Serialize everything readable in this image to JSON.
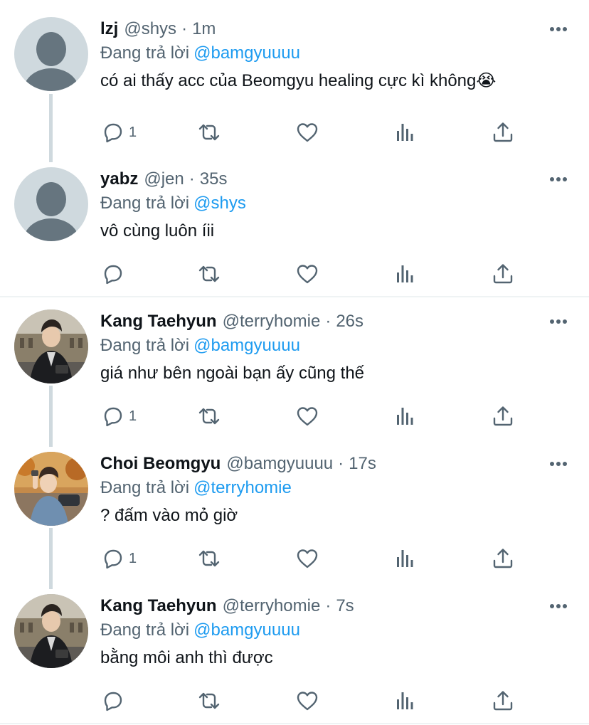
{
  "tweets": [
    {
      "name": "lzj",
      "handle": "@shys",
      "separator": "·",
      "time": "1m",
      "reply_prefix": "Đang trả lời",
      "reply_to": "@bamgyuuuu",
      "text": "có ai thấy acc của Beomgyu healing cực kì không😭",
      "reply_count": "1",
      "avatar": "default-avatar"
    },
    {
      "name": "yabz",
      "handle": "@jen",
      "separator": "·",
      "time": "35s",
      "reply_prefix": "Đang trả lời",
      "reply_to": "@shys",
      "text": "vô cùng luôn íii",
      "reply_count": "",
      "avatar": "default-avatar"
    },
    {
      "name": "Kang Taehyun",
      "handle": "@terryhomie",
      "separator": "·",
      "time": "26s",
      "reply_prefix": "Đang trả lời",
      "reply_to": "@bamgyuuuu",
      "text": "giá như bên ngoài bạn ấy cũng thế",
      "reply_count": "1",
      "avatar": "photo-avatar-street"
    },
    {
      "name": "Choi Beomgyu",
      "handle": "@bamgyuuuu",
      "separator": "·",
      "time": "17s",
      "reply_prefix": "Đang trả lời",
      "reply_to": "@terryhomie",
      "text": "? đấm vào mỏ giờ",
      "reply_count": "1",
      "avatar": "photo-avatar-autumn"
    },
    {
      "name": "Kang Taehyun",
      "handle": "@terryhomie",
      "separator": "·",
      "time": "7s",
      "reply_prefix": "Đang trả lời",
      "reply_to": "@bamgyuuuu",
      "text": "bằng môi anh thì được",
      "reply_count": "",
      "avatar": "photo-avatar-street"
    }
  ],
  "colors": {
    "text_primary": "#0f1419",
    "text_secondary": "#536471",
    "link": "#1d9bf0",
    "thread_line": "#cfd9de",
    "divider": "#eff3f4"
  },
  "icons": {
    "more": "more-horizontal-icon",
    "reply": "reply-icon",
    "retweet": "retweet-icon",
    "like": "heart-icon",
    "views": "views-icon",
    "share": "share-icon"
  }
}
